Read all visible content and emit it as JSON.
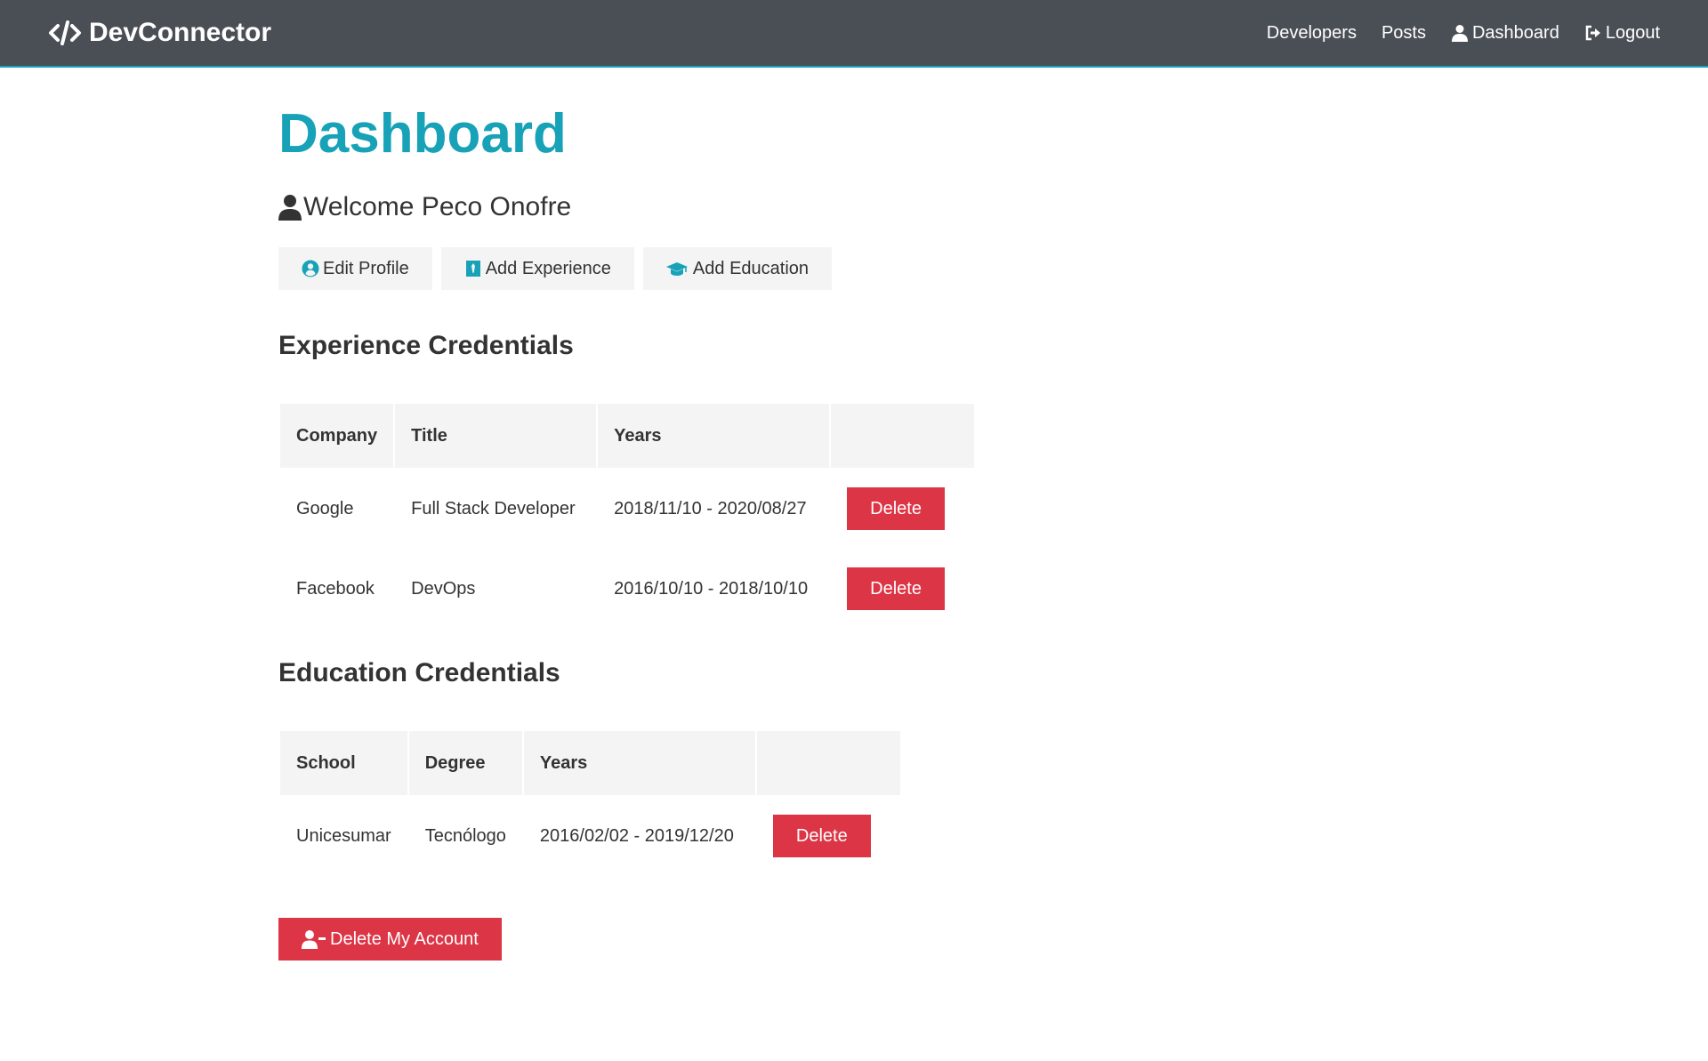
{
  "navbar": {
    "brand": "DevConnector",
    "brand_icon": "code-icon",
    "links": [
      {
        "label": "Developers"
      },
      {
        "label": "Posts"
      },
      {
        "label": "Dashboard",
        "icon": "user-icon"
      },
      {
        "label": "Logout",
        "icon": "sign-out-icon"
      }
    ]
  },
  "page": {
    "title": "Dashboard",
    "welcome": "Welcome Peco Onofre"
  },
  "actions": {
    "edit_profile": "Edit Profile",
    "add_experience": "Add Experience",
    "add_education": "Add Education"
  },
  "experience": {
    "title": "Experience Credentials",
    "headers": [
      "Company",
      "Title",
      "Years",
      ""
    ],
    "rows": [
      {
        "company": "Google",
        "title": "Full Stack Developer",
        "years": "2018/11/10 - 2020/08/27",
        "action": "Delete"
      },
      {
        "company": "Facebook",
        "title": "DevOps",
        "years": "2016/10/10 - 2018/10/10",
        "action": "Delete"
      }
    ]
  },
  "education": {
    "title": "Education Credentials",
    "headers": [
      "School",
      "Degree",
      "Years",
      ""
    ],
    "rows": [
      {
        "school": "Unicesumar",
        "degree": "Tecnólogo",
        "years": "2016/02/02 - 2019/12/20",
        "action": "Delete"
      }
    ]
  },
  "delete_account": "Delete My Account",
  "colors": {
    "primary": "#17a2b8",
    "dark": "#4a4f56",
    "danger": "#dc3545",
    "light": "#f4f4f4"
  }
}
